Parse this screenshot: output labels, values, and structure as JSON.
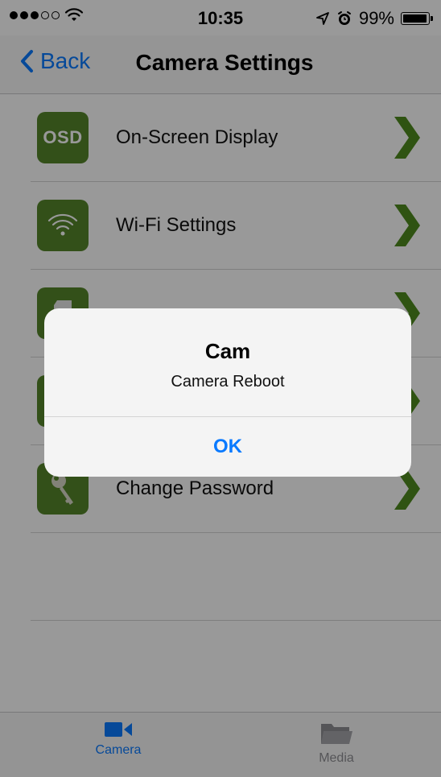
{
  "status_bar": {
    "time": "10:35",
    "battery_text": "99%",
    "battery_level": 0.99,
    "signal_filled": 3,
    "signal_total": 5,
    "icons": [
      "wifi-icon",
      "location-arrow-icon",
      "alarm-clock-icon",
      "battery-icon"
    ]
  },
  "nav": {
    "back_label": "Back",
    "title": "Camera Settings"
  },
  "settings": [
    {
      "label": "On-Screen Display",
      "icon": "osd-icon",
      "icon_text": "OSD"
    },
    {
      "label": "Wi-Fi Settings",
      "icon": "wifi-icon"
    },
    {
      "label": "",
      "icon": "sd-card-icon"
    },
    {
      "label": "",
      "icon": "camera-reboot-icon"
    },
    {
      "label": "Change Password",
      "icon": "key-icon"
    }
  ],
  "alert": {
    "title": "Cam",
    "message": "Camera Reboot",
    "ok_label": "OK"
  },
  "tab_bar": {
    "tabs": [
      {
        "label": "Camera",
        "icon": "video-camera-icon",
        "selected": true
      },
      {
        "label": "Media",
        "icon": "folder-icon",
        "selected": false
      }
    ]
  },
  "colors": {
    "accent": "#0a7aff",
    "icon_green": "#56862b",
    "chevron_green": "#4f8a1f"
  }
}
